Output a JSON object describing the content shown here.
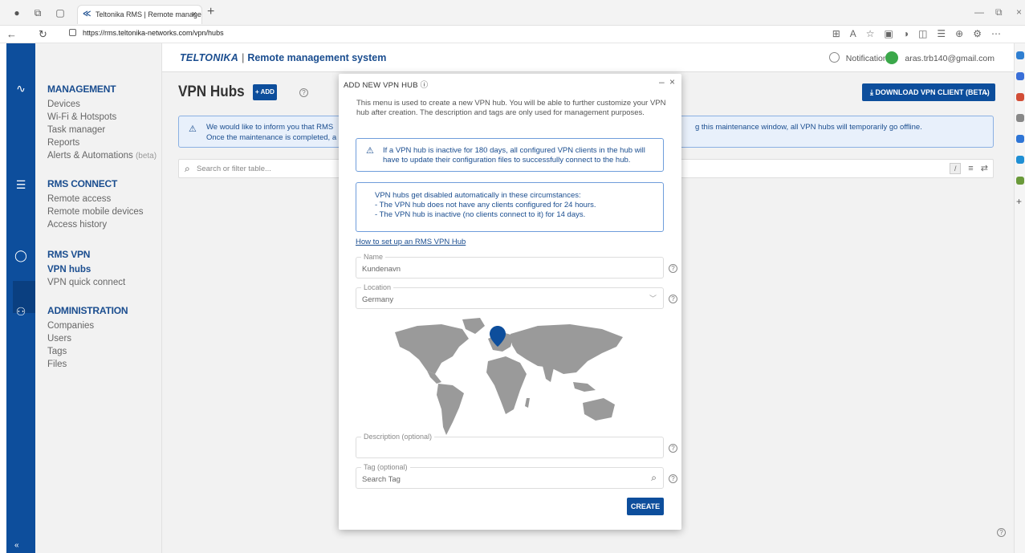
{
  "browser": {
    "tab_title": "Teltonika RMS | Remote manage",
    "url": "https://rms.teltonika-networks.com/vpn/hubs"
  },
  "header": {
    "brand": "TELTONIKA",
    "separator": "|",
    "system": "Remote management system",
    "notifications": "Notifications",
    "user_email": "aras.trb140@gmail.com"
  },
  "sidebar": {
    "sections": [
      {
        "title": "MANAGEMENT",
        "items": [
          "Devices",
          "Wi-Fi & Hotspots",
          "Task manager",
          "Reports",
          "Alerts & Automations"
        ],
        "beta_suffix": "(beta)"
      },
      {
        "title": "RMS CONNECT",
        "items": [
          "Remote access",
          "Remote mobile devices",
          "Access history"
        ]
      },
      {
        "title": "RMS VPN",
        "items": [
          "VPN hubs",
          "VPN quick connect"
        ]
      },
      {
        "title": "ADMINISTRATION",
        "items": [
          "Companies",
          "Users",
          "Tags",
          "Files"
        ]
      }
    ],
    "collapse": "«"
  },
  "page": {
    "title": "VPN Hubs",
    "add_label": "+ ADD",
    "download_label": "⤓ DOWNLOAD VPN CLIENT (BETA)",
    "info_line1": "We would like to inform you that RMS",
    "info_line2": "Once the maintenance is completed, a",
    "info_right": "g this maintenance window, all VPN hubs will temporarily go offline.",
    "search_placeholder": "Search or filter table..."
  },
  "modal": {
    "title": "ADD NEW VPN HUB ⓘ",
    "description": "This menu is used to create a new VPN hub. You will be able to further customize your VPN hub after creation. The description and tags are only used for management purposes.",
    "warning": "If a VPN hub is inactive for 180 days, all configured VPN clients in the hub will have to update their configuration files to successfully connect to the hub.",
    "disable_title": "VPN hubs get disabled automatically in these circumstances:",
    "disable_1": "- The VPN hub does not have any clients configured for 24 hours.",
    "disable_2": "- The VPN hub is inactive (no clients connect to it) for 14 days.",
    "howto_link": "How to set up an RMS VPN Hub",
    "name_label": "Name",
    "name_value": "Kundenavn",
    "location_label": "Location",
    "location_value": "Germany",
    "description_label": "Description (optional)",
    "tag_label": "Tag (optional)",
    "tag_placeholder": "Search Tag",
    "create_label": "CREATE"
  },
  "colors": {
    "brand_blue": "#0d4e9c",
    "info_bg": "#e8f0fb",
    "info_border": "#8bb0e3",
    "map_land": "#9a9a9a"
  }
}
